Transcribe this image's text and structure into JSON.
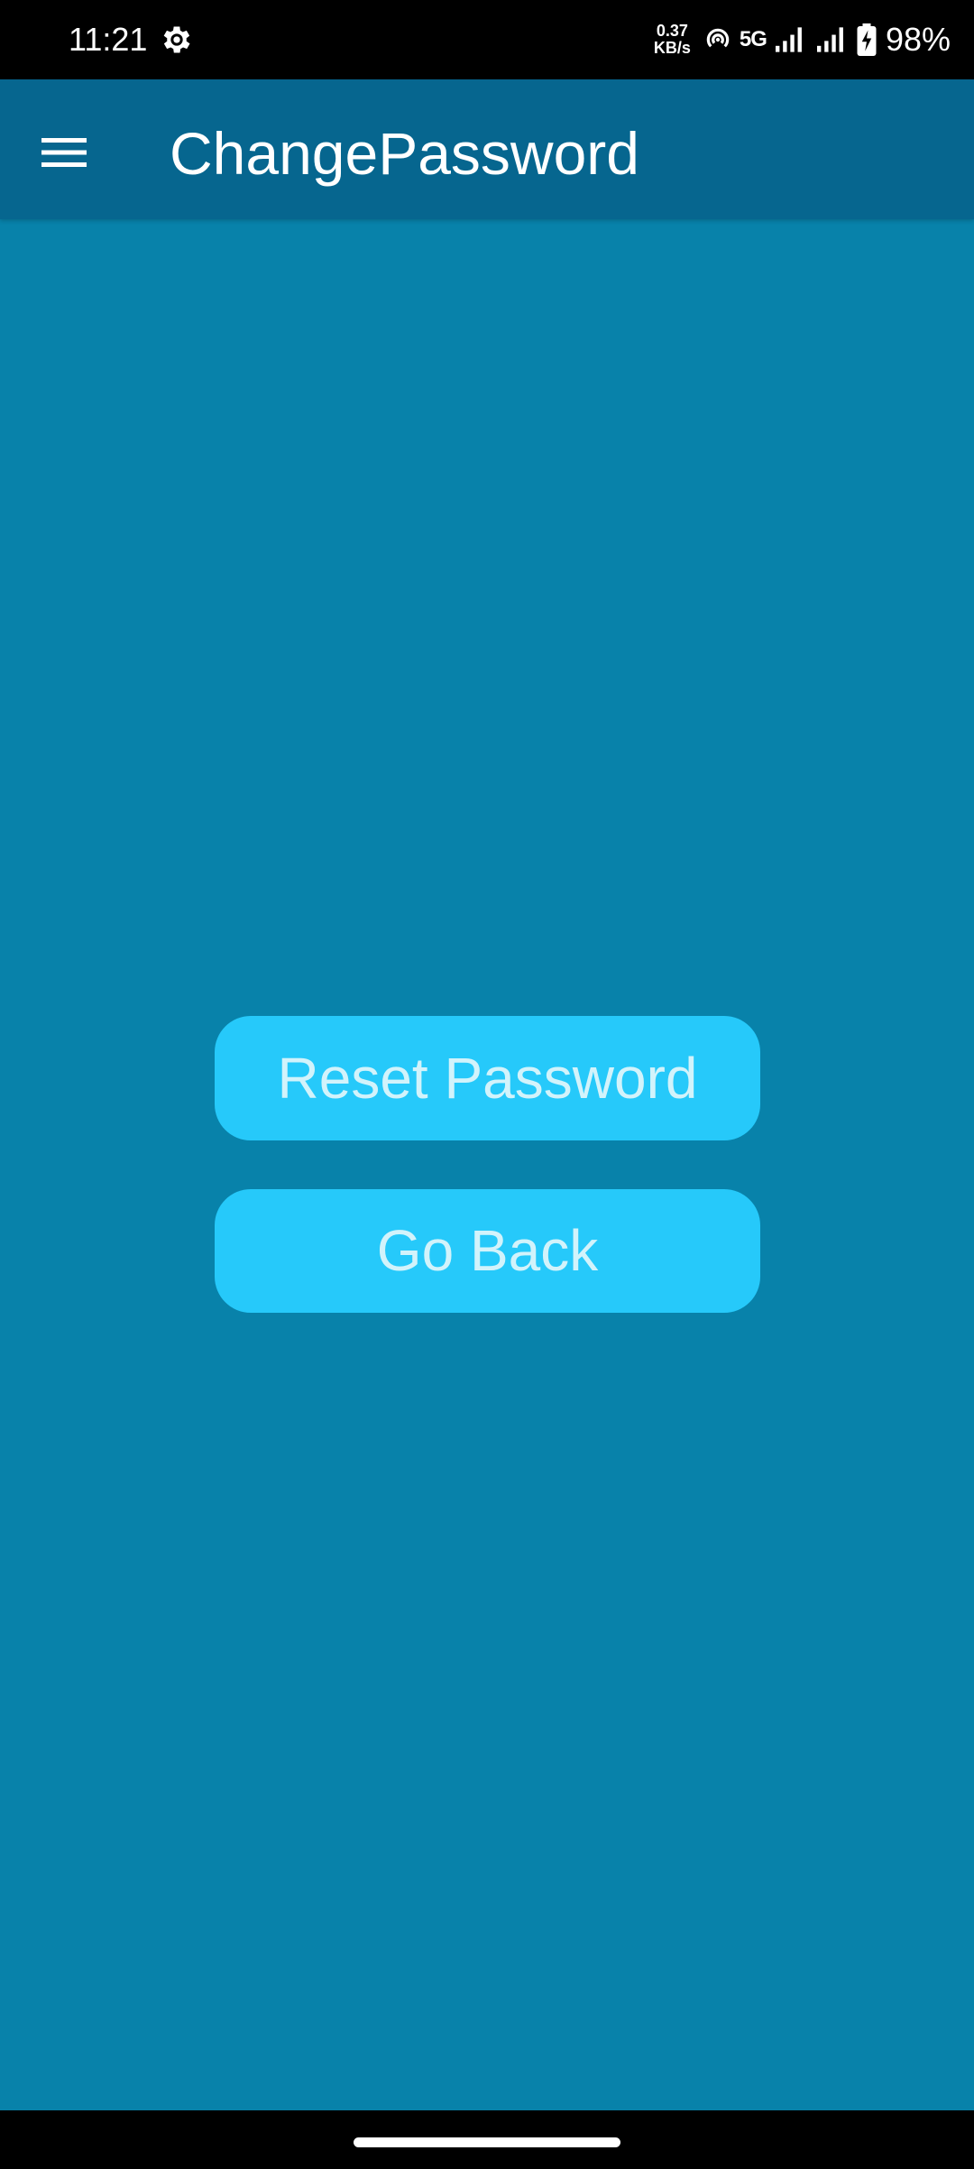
{
  "status_bar": {
    "time": "11:21",
    "gear_icon": "gear-icon",
    "net_speed_value": "0.37",
    "net_speed_unit": "KB/s",
    "hotspot_icon": "hotspot-icon",
    "network_type": "5G",
    "signal_icons": [
      "signal-icon",
      "signal-icon"
    ],
    "battery_icon": "battery-charging-icon",
    "battery_percent": "98%"
  },
  "app_bar": {
    "menu_icon": "menu-icon",
    "title": "ChangePassword",
    "background": "#06668f"
  },
  "main": {
    "background": "#0882aa",
    "reset_button_label": "Reset Password",
    "back_button_label": "Go Back",
    "button_color": "#26c9fa",
    "button_text_color": "#d2f3fb"
  },
  "nav_bar": {
    "home_indicator": "home-indicator"
  }
}
